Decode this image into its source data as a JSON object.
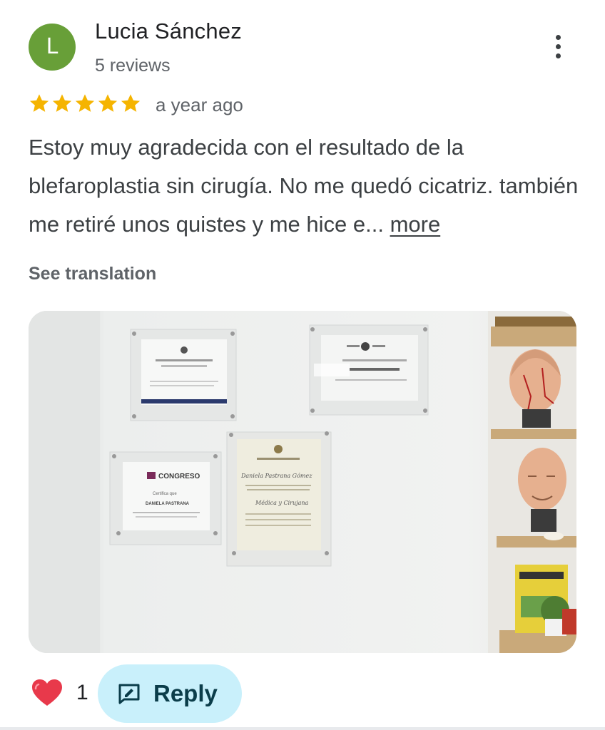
{
  "review": {
    "avatar_letter": "L",
    "avatar_color": "#689f38",
    "author_name": "Lucia Sánchez",
    "author_reviews": "5 reviews",
    "rating": 5,
    "rating_max": 5,
    "time_ago": "a year ago",
    "text": "Estoy muy agradecida con el resultado de la blefaroplastia sin cirugía. No me quedó cicatriz. también me retiré unos quistes y me hice e...",
    "more_label": "more",
    "translate_label": "See translation"
  },
  "photo": {
    "description_icon": "photo-of-certificates-on-wall",
    "certificates": [
      {
        "heading": "CONGRESO",
        "line2": "Certifica que",
        "line3": "DANIELA PASTRANA"
      },
      {
        "heading": "Daniela Pastrana Gómez",
        "line2": "Médica y Cirujana"
      },
      {
        "heading": "Daniela Pastrana Gómez"
      },
      {
        "heading": "Dra. Daniela Pastrana"
      }
    ]
  },
  "footer": {
    "like_count": "1",
    "reply_label": "Reply"
  },
  "colors": {
    "star": "#f5b400",
    "reply_bg": "#c9f0fb",
    "heart": "#e8394b"
  }
}
